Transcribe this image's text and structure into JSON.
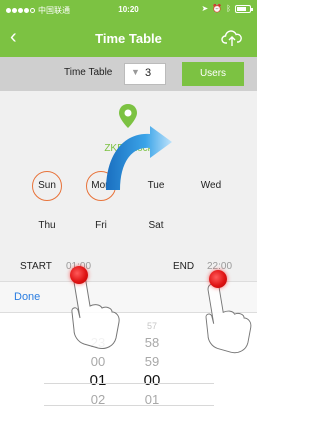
{
  "status_bar": {
    "carrier": "中国联通",
    "time": "10:20"
  },
  "nav": {
    "back_icon": "chevron-left-icon",
    "title": "Time Table",
    "cloud_icon": "cloud-upload-icon"
  },
  "timetable": {
    "label": "Time Table",
    "value": "3",
    "users_button": "Users"
  },
  "lock": {
    "name": "ZKBioLock",
    "icon": "location-pin-icon"
  },
  "days": [
    {
      "label": "Sun",
      "selected": true
    },
    {
      "label": "Mon",
      "selected": true
    },
    {
      "label": "Tue",
      "selected": false
    },
    {
      "label": "Wed",
      "selected": false
    },
    {
      "label": "Thu",
      "selected": false
    },
    {
      "label": "Fri",
      "selected": false
    },
    {
      "label": "Sat",
      "selected": false
    }
  ],
  "schedule": {
    "start_label": "START",
    "start_time": "01:00",
    "end_label": "END",
    "end_time": "22:00"
  },
  "toolbar": {
    "done_label": "Done"
  },
  "picker": {
    "hours": [
      "23",
      "00",
      "01",
      "02"
    ],
    "minutes": [
      "57",
      "58",
      "59",
      "00",
      "01"
    ],
    "selected_hour": "01",
    "selected_minute": "00"
  },
  "colors": {
    "brand_green": "#7cc242",
    "day_ring": "#e8733a",
    "link_blue": "#2a7de1",
    "arc_blue": "#1e8fd6"
  }
}
